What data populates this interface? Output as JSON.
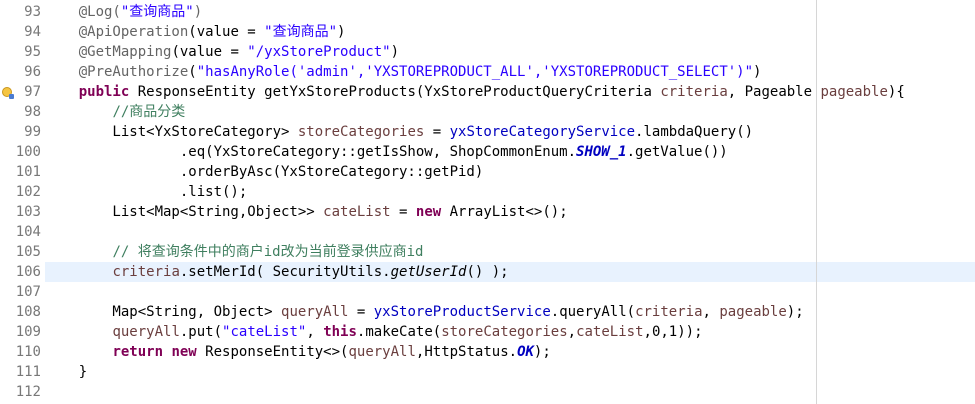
{
  "editor": {
    "lines": [
      {
        "num": "93",
        "tokens": [
          {
            "t": "    "
          },
          {
            "t": "@Log(",
            "c": "ann"
          },
          {
            "t": "\"查询商品\"",
            "c": "str"
          },
          {
            "t": ")",
            "c": "ann"
          }
        ]
      },
      {
        "num": "94",
        "tokens": [
          {
            "t": "    "
          },
          {
            "t": "@ApiOperation",
            "c": "ann"
          },
          {
            "t": "(value = "
          },
          {
            "t": "\"查询商品\"",
            "c": "str"
          },
          {
            "t": ")"
          }
        ]
      },
      {
        "num": "95",
        "tokens": [
          {
            "t": "    "
          },
          {
            "t": "@GetMapping",
            "c": "ann"
          },
          {
            "t": "(value = "
          },
          {
            "t": "\"/yxStoreProduct\"",
            "c": "str"
          },
          {
            "t": ")"
          }
        ]
      },
      {
        "num": "96",
        "tokens": [
          {
            "t": "    "
          },
          {
            "t": "@PreAuthorize",
            "c": "ann"
          },
          {
            "t": "("
          },
          {
            "t": "\"hasAnyRole('admin','YXSTOREPRODUCT_ALL','YXSTOREPRODUCT_SELECT')\"",
            "c": "str"
          },
          {
            "t": ")"
          }
        ]
      },
      {
        "num": "97",
        "marker": "annotation-marker",
        "tokens": [
          {
            "t": "    "
          },
          {
            "t": "public",
            "c": "kw"
          },
          {
            "t": " ResponseEntity getYxStoreProducts(YxStoreProductQueryCriteria "
          },
          {
            "t": "criteria",
            "c": "param"
          },
          {
            "t": ", Pageable "
          },
          {
            "t": "pageable",
            "c": "param"
          },
          {
            "t": "){"
          }
        ]
      },
      {
        "num": "98",
        "tokens": [
          {
            "t": "        "
          },
          {
            "t": "//商品分类",
            "c": "cmt"
          }
        ]
      },
      {
        "num": "99",
        "tokens": [
          {
            "t": "        List<YxStoreCategory> "
          },
          {
            "t": "storeCategories",
            "c": "local"
          },
          {
            "t": " = "
          },
          {
            "t": "yxStoreCategoryService",
            "c": "field"
          },
          {
            "t": ".lambdaQuery()"
          }
        ]
      },
      {
        "num": "100",
        "tokens": [
          {
            "t": "                .eq(YxStoreCategory::getIsShow, ShopCommonEnum."
          },
          {
            "t": "SHOW_1",
            "c": "static"
          },
          {
            "t": ".getValue())"
          }
        ]
      },
      {
        "num": "101",
        "tokens": [
          {
            "t": "                .orderByAsc(YxStoreCategory::getPid)"
          }
        ]
      },
      {
        "num": "102",
        "tokens": [
          {
            "t": "                .list();"
          }
        ]
      },
      {
        "num": "103",
        "tokens": [
          {
            "t": "        List<Map<String,Object>> "
          },
          {
            "t": "cateList",
            "c": "local"
          },
          {
            "t": " = "
          },
          {
            "t": "new",
            "c": "kw"
          },
          {
            "t": " ArrayList<>();"
          }
        ]
      },
      {
        "num": "104",
        "tokens": [
          {
            "t": ""
          }
        ]
      },
      {
        "num": "105",
        "tokens": [
          {
            "t": "        "
          },
          {
            "t": "// 将查询条件中的商户id改为当前登录供应商id",
            "c": "cmt"
          }
        ]
      },
      {
        "num": "106",
        "current": true,
        "tokens": [
          {
            "t": "        "
          },
          {
            "t": "criteria",
            "c": "param"
          },
          {
            "t": ".setMerId( SecurityUtils."
          },
          {
            "t": "getUserId",
            "c": "italic"
          },
          {
            "t": "() );"
          }
        ]
      },
      {
        "num": "107",
        "tokens": [
          {
            "t": ""
          }
        ]
      },
      {
        "num": "108",
        "tokens": [
          {
            "t": "        Map<String, Object> "
          },
          {
            "t": "queryAll",
            "c": "local"
          },
          {
            "t": " = "
          },
          {
            "t": "yxStoreProductService",
            "c": "field"
          },
          {
            "t": ".queryAll("
          },
          {
            "t": "criteria",
            "c": "param"
          },
          {
            "t": ", "
          },
          {
            "t": "pageable",
            "c": "param"
          },
          {
            "t": ");"
          }
        ]
      },
      {
        "num": "109",
        "tokens": [
          {
            "t": "        "
          },
          {
            "t": "queryAll",
            "c": "local"
          },
          {
            "t": ".put("
          },
          {
            "t": "\"cateList\"",
            "c": "str"
          },
          {
            "t": ", "
          },
          {
            "t": "this",
            "c": "kw"
          },
          {
            "t": ".makeCate("
          },
          {
            "t": "storeCategories",
            "c": "local"
          },
          {
            "t": ","
          },
          {
            "t": "cateList",
            "c": "local"
          },
          {
            "t": ",0,1));"
          }
        ]
      },
      {
        "num": "110",
        "tokens": [
          {
            "t": "        "
          },
          {
            "t": "return",
            "c": "kw"
          },
          {
            "t": " "
          },
          {
            "t": "new",
            "c": "kw"
          },
          {
            "t": " ResponseEntity<>("
          },
          {
            "t": "queryAll",
            "c": "local"
          },
          {
            "t": ",HttpStatus."
          },
          {
            "t": "OK",
            "c": "static"
          },
          {
            "t": ");"
          }
        ]
      },
      {
        "num": "111",
        "tokens": [
          {
            "t": "    }"
          }
        ]
      },
      {
        "num": "112",
        "tokens": [
          {
            "t": ""
          }
        ]
      }
    ]
  },
  "colors": {
    "annotation": "#646464",
    "string": "#2a00ff",
    "keyword": "#7f0055",
    "comment": "#3f7f5f",
    "field": "#0000c0",
    "local_variable": "#6a3e3e",
    "current_line": "#e8f2fe",
    "line_number": "#787878"
  }
}
